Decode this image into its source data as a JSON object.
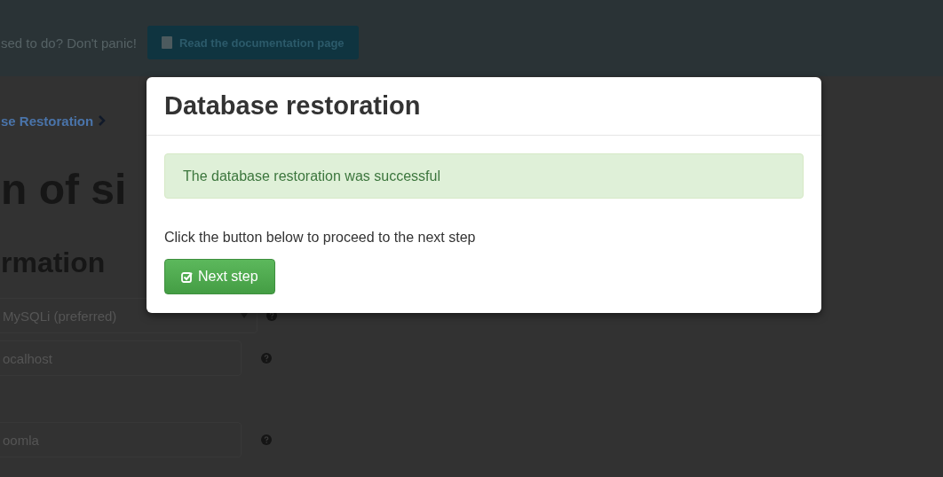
{
  "header": {
    "help_text": "sed to do? Don't panic!",
    "doc_button": "Read the documentation page"
  },
  "breadcrumb": "se Restoration",
  "page_heading": "n of si",
  "section_heading": "rmation",
  "fields": [
    {
      "kind": "select",
      "value": "MySQLi (preferred)"
    },
    {
      "kind": "text",
      "value": "ocalhost"
    },
    {
      "kind": "text",
      "value": "oomla"
    }
  ],
  "modal": {
    "title": "Database restoration",
    "alert": "The database restoration was successful",
    "message": "Click the button below to proceed to the next step",
    "button": "Next step"
  }
}
